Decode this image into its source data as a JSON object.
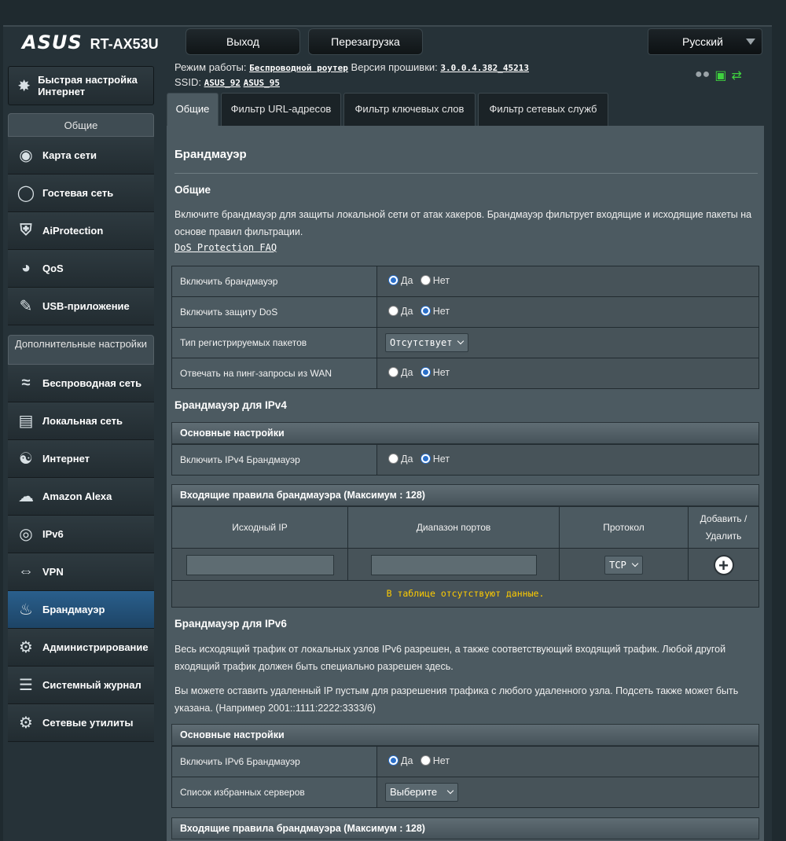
{
  "header": {
    "brand": "ASUS",
    "model": "RT-AX53U",
    "logout_label": "Выход",
    "reboot_label": "Перезагрузка",
    "language": "Русский",
    "mode_label": "Режим работы:",
    "mode_value": "Беспроводной роутер",
    "firmware_label": "Версия прошивки:",
    "firmware_value": "3.0.0.4.382_45213",
    "ssid_label": "SSID:",
    "ssid_1": "ASUS_92",
    "ssid_2": "ASUS_95"
  },
  "sidebar": {
    "quick_setup": "Быстрая настройка Интернет",
    "general_header": "Общие",
    "general_items": [
      {
        "label": "Карта сети",
        "icon": "network-map-icon"
      },
      {
        "label": "Гостевая сеть",
        "icon": "guest-network-icon"
      },
      {
        "label": "AiProtection",
        "icon": "aiprotection-icon"
      },
      {
        "label": "QoS",
        "icon": "qos-icon"
      },
      {
        "label": "USB-приложение",
        "icon": "usb-app-icon"
      }
    ],
    "advanced_header": "Дополнительные настройки",
    "advanced_items": [
      {
        "label": "Беспроводная сеть",
        "icon": "wireless-icon"
      },
      {
        "label": "Локальная сеть",
        "icon": "lan-icon"
      },
      {
        "label": "Интернет",
        "icon": "internet-icon"
      },
      {
        "label": "Amazon Alexa",
        "icon": "alexa-icon"
      },
      {
        "label": "IPv6",
        "icon": "ipv6-icon"
      },
      {
        "label": "VPN",
        "icon": "vpn-icon"
      },
      {
        "label": "Брандмауэр",
        "icon": "firewall-icon",
        "active": true
      },
      {
        "label": "Администрирование",
        "icon": "admin-gear-icon"
      },
      {
        "label": "Системный журнал",
        "icon": "syslog-icon"
      },
      {
        "label": "Сетевые утилиты",
        "icon": "network-tools-icon"
      }
    ]
  },
  "tabs": [
    {
      "label": "Общие",
      "active": true
    },
    {
      "label": "Фильтр URL-адресов"
    },
    {
      "label": "Фильтр ключевых слов"
    },
    {
      "label": "Фильтр сетевых служб"
    }
  ],
  "main": {
    "title": "Брандмауэр",
    "general_heading": "Общие",
    "intro": "Включите брандмауэр для защиты локальной сети от атак хакеров. Брандмауэр фильтрует входящие и исходящие пакеты на основе правил фильтрации.",
    "faq_link": "DoS Protection FAQ",
    "yes": "Да",
    "no": "Нет",
    "general_rows": {
      "enable_firewall": "Включить брандмауэр",
      "enable_dos": "Включить защиту DoS",
      "log_type": "Тип регистрируемых пакетов",
      "log_type_value": "Отсутствует",
      "ping_wan": "Отвечать на пинг-запросы из WAN"
    },
    "ipv4_heading": "Брандмауэр для IPv4",
    "basic_settings": "Основные настройки",
    "enable_ipv4": "Включить IPv4 Брандмауэр",
    "inbound_rules": "Входящие правила брандмауэра (Максимум : 128)",
    "col_source_ip": "Исходный IP",
    "col_port_range": "Диапазон портов",
    "col_protocol": "Протокол",
    "col_add_remove": "Добавить / Удалить",
    "protocol_value": "TCP",
    "no_data": "В таблице отсутствуют данные.",
    "ipv6_heading": "Брандмауэр для IPv6",
    "ipv6_para1": "Весь исходящий трафик от локальных узлов IPv6 разрешен, а также соответствующий входящий трафик. Любой другой входящий трафик должен быть специально разрешен здесь.",
    "ipv6_para2": "Вы можете оставить удаленный IP пустым для разрешения трафика с любого удаленного узла. Подсеть также может быть указана. (Например 2001::1111:2222:3333/6)",
    "basic_settings_2": "Основные настройки",
    "enable_ipv6": "Включить IPv6 Брандмауэр",
    "fav_servers": "Список избранных серверов",
    "fav_servers_value": "Выберите",
    "inbound_rules_2": "Входящие правила брандмауэра (Максимум : 128)"
  }
}
